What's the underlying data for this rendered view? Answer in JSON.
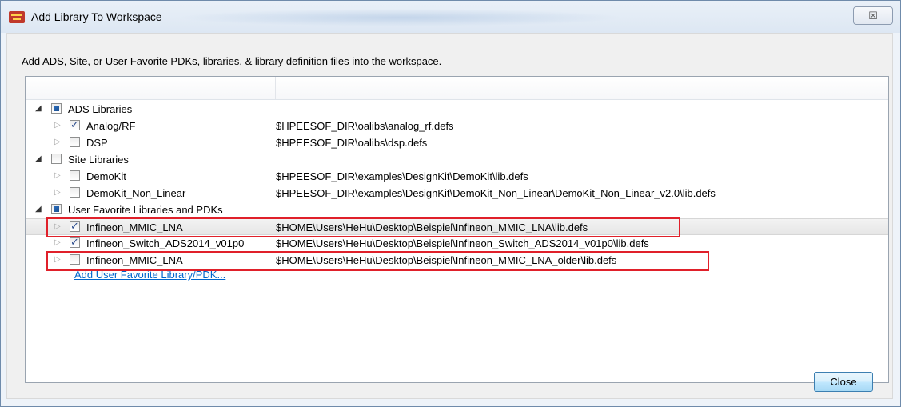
{
  "window": {
    "title": "Add Library To Workspace",
    "close_glyph": "☒"
  },
  "description": "Add ADS, Site, or User Favorite PDKs, libraries, & library definition files into the workspace.",
  "tree": {
    "rows": [
      {
        "name": "ADS Libraries",
        "path": "",
        "level": 0,
        "expander": "open",
        "check": "partial"
      },
      {
        "name": "Analog/RF",
        "path": "$HPEESOF_DIR\\oalibs\\analog_rf.defs",
        "level": 1,
        "expander": "closed",
        "check": "checked"
      },
      {
        "name": "DSP",
        "path": "$HPEESOF_DIR\\oalibs\\dsp.defs",
        "level": 1,
        "expander": "closed",
        "check": "unchecked"
      },
      {
        "name": "Site Libraries",
        "path": "",
        "level": 0,
        "expander": "open",
        "check": "unchecked"
      },
      {
        "name": "DemoKit",
        "path": "$HPEESOF_DIR\\examples\\DesignKit\\DemoKit\\lib.defs",
        "level": 1,
        "expander": "closed",
        "check": "unchecked"
      },
      {
        "name": "DemoKit_Non_Linear",
        "path": "$HPEESOF_DIR\\examples\\DesignKit\\DemoKit_Non_Linear\\DemoKit_Non_Linear_v2.0\\lib.defs",
        "level": 1,
        "expander": "closed",
        "check": "unchecked"
      },
      {
        "name": "User Favorite Libraries and PDKs",
        "path": "",
        "level": 0,
        "expander": "open",
        "check": "partial"
      },
      {
        "name": "Infineon_MMIC_LNA",
        "path": "$HOME\\Users\\HeHu\\Desktop\\Beispiel\\Infineon_MMIC_LNA\\lib.defs",
        "level": 1,
        "expander": "closed",
        "check": "checked"
      },
      {
        "name": "Infineon_Switch_ADS2014_v01p0",
        "path": "$HOME\\Users\\HeHu\\Desktop\\Beispiel\\Infineon_Switch_ADS2014_v01p0\\lib.defs",
        "level": 1,
        "expander": "closed",
        "check": "checked"
      },
      {
        "name": "Infineon_MMIC_LNA",
        "path": "$HOME\\Users\\HeHu\\Desktop\\Beispiel\\Infineon_MMIC_LNA_older\\lib.defs",
        "level": 1,
        "expander": "closed",
        "check": "unchecked"
      }
    ],
    "add_link": "Add User Favorite Library/PDK..."
  },
  "buttons": {
    "close": "Close"
  },
  "colors": {
    "highlight": "#e0202a",
    "link": "#0066cc"
  }
}
